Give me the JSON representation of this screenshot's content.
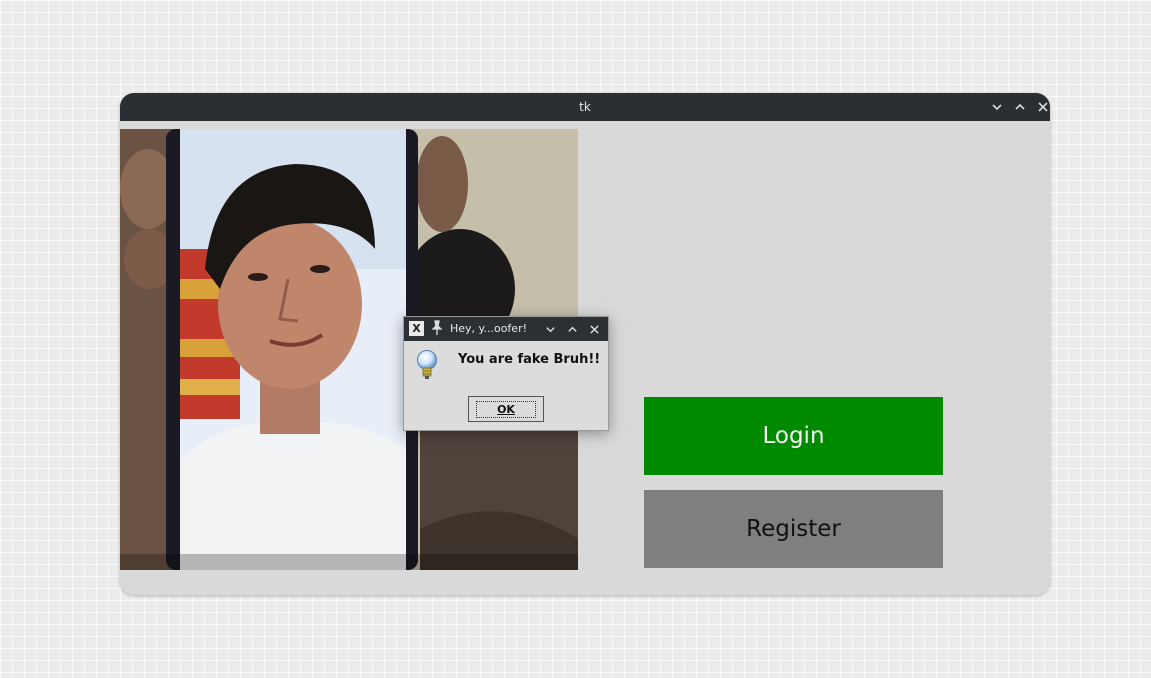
{
  "window": {
    "title": "tk",
    "controls": [
      "chevron-down-icon",
      "chevron-up-icon",
      "close-icon"
    ]
  },
  "webcam": {
    "description_icon": "camera-feed"
  },
  "buttons": {
    "login_label": "Login",
    "register_label": "Register",
    "login_color": "#008a00",
    "register_color": "#7f7f7f"
  },
  "dialog": {
    "title": "Hey, y...oofer!",
    "message": "You are fake Bruh!!",
    "ok_label": "OK",
    "icon": "lightbulb-icon"
  }
}
